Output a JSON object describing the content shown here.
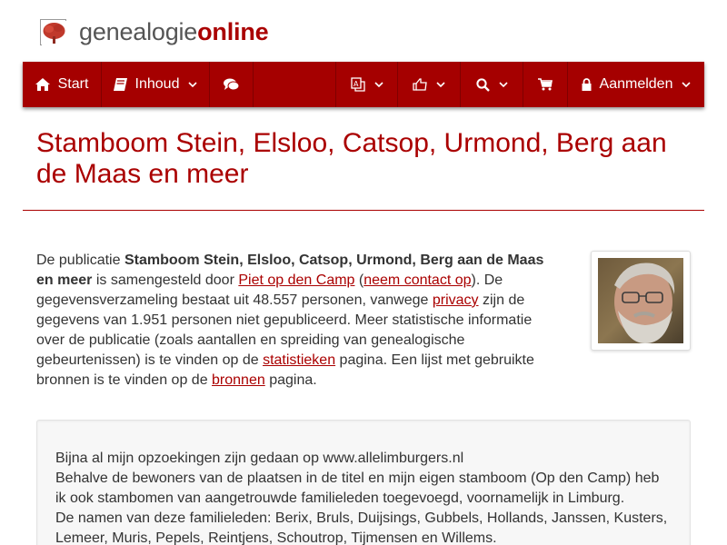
{
  "logo": {
    "part1": "genealogie",
    "part2": "online",
    "icon": "tree-icon"
  },
  "nav": {
    "start": "Start",
    "inhoud": "Inhoud",
    "aanmelden": "Aanmelden",
    "icons": [
      "home-icon",
      "book-icon",
      "chat-icon",
      "translate-icon",
      "share-icon",
      "search-icon",
      "cart-icon",
      "lock-icon"
    ]
  },
  "title": "Stamboom Stein, Elsloo, Catsop, Urmond, Berg aan de Maas en meer",
  "intro": {
    "t1": "De publicatie ",
    "pub_name": "Stamboom Stein, Elsloo, Catsop, Urmond, Berg aan de Maas en meer",
    "t2": " is samengesteld door ",
    "author_link": "Piet op den Camp",
    "t3": " (",
    "contact_link": "neem contact op",
    "t4": "). De gegevensverzameling bestaat uit 48.557 personen, vanwege ",
    "privacy_link": "privacy",
    "t5": " zijn de gegevens van 1.951 personen niet gepubliceerd. Meer statistische informatie over de publicatie (zoals aantallen en spreiding van genealogische gebeurtenissen) is te vinden op de ",
    "stats_link": "statistieken",
    "t6": " pagina. Een lijst met gebruikte bronnen is te vinden op de ",
    "sources_link": "bronnen",
    "t7": " pagina."
  },
  "panel": {
    "line1": "Bijna al mijn opzoekingen zijn gedaan op www.allelimburgers.nl",
    "line2": "Behalve de bewoners van de plaatsen in de titel en mijn eigen stamboom (Op den Camp) heb ik ook stambomen van aangetrouwde familieleden toegevoegd, voornamelijk in Limburg.",
    "line3": "De namen van deze familieleden: Berix, Bruls, Duijsings, Gubbels, Hollands, Janssen, Kusters, Lemeer, Muris, Pepels, Reintjens, Schoutrop, Tijmensen en Willems."
  },
  "colors": {
    "brand": "#aa0000",
    "navbar": "#a50000",
    "text": "#333333"
  }
}
